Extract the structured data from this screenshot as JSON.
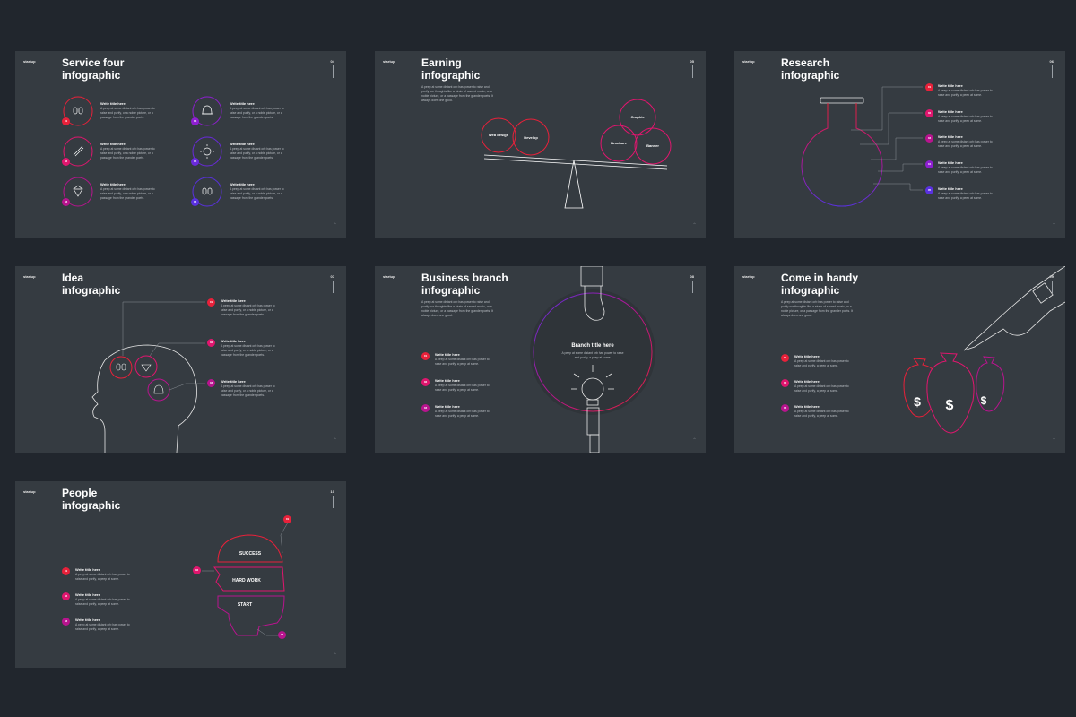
{
  "brand": "startup",
  "item_title": "Write title here",
  "text_short": "A peep at some distant orb has power to raise and purify, a peep at some.",
  "text_long": "A peep at some distant orb has power to raise and purify, or a noble picture, or a passage from the grander poets.",
  "text_para": "A peep at some distant orb has power to raise and purify our thoughts like a strain of sacred music, or a noble picture, or a passage from the grander poets. It always does one good.",
  "colors": {
    "red": "#e8213a",
    "pink": "#e0166e",
    "magenta": "#b8148e",
    "purple": "#8e1fd0",
    "blue": "#5a31e0"
  },
  "slides": [
    {
      "num": "04",
      "title_l1": "Service four",
      "title_l2": "infographic",
      "badges": [
        "01",
        "02",
        "03",
        "04",
        "05",
        "06"
      ]
    },
    {
      "num": "05",
      "title_l1": "Earning",
      "title_l2": "infographic",
      "bubbles": [
        "Web design",
        "Develop",
        "Graphic",
        "Brochure",
        "Banner"
      ]
    },
    {
      "num": "06",
      "title_l1": "Research",
      "title_l2": "infographic",
      "badges": [
        "01",
        "02",
        "03",
        "04",
        "05"
      ]
    },
    {
      "num": "07",
      "title_l1": "Idea",
      "title_l2": "infographic",
      "badges": [
        "01",
        "02",
        "03"
      ]
    },
    {
      "num": "08",
      "title_l1": "Business branch",
      "title_l2": "infographic",
      "center_title": "Branch title here",
      "badges": [
        "01",
        "02",
        "03"
      ]
    },
    {
      "num": "09",
      "title_l1": "Come in handy",
      "title_l2": "infographic",
      "badges": [
        "01",
        "02",
        "03"
      ]
    },
    {
      "num": "10",
      "title_l1": "People",
      "title_l2": "infographic",
      "labels": [
        "SUCCESS",
        "HARD WORK",
        "START"
      ],
      "badges": [
        "01",
        "02",
        "03"
      ],
      "head_badges": [
        "01",
        "02",
        "03"
      ]
    }
  ]
}
